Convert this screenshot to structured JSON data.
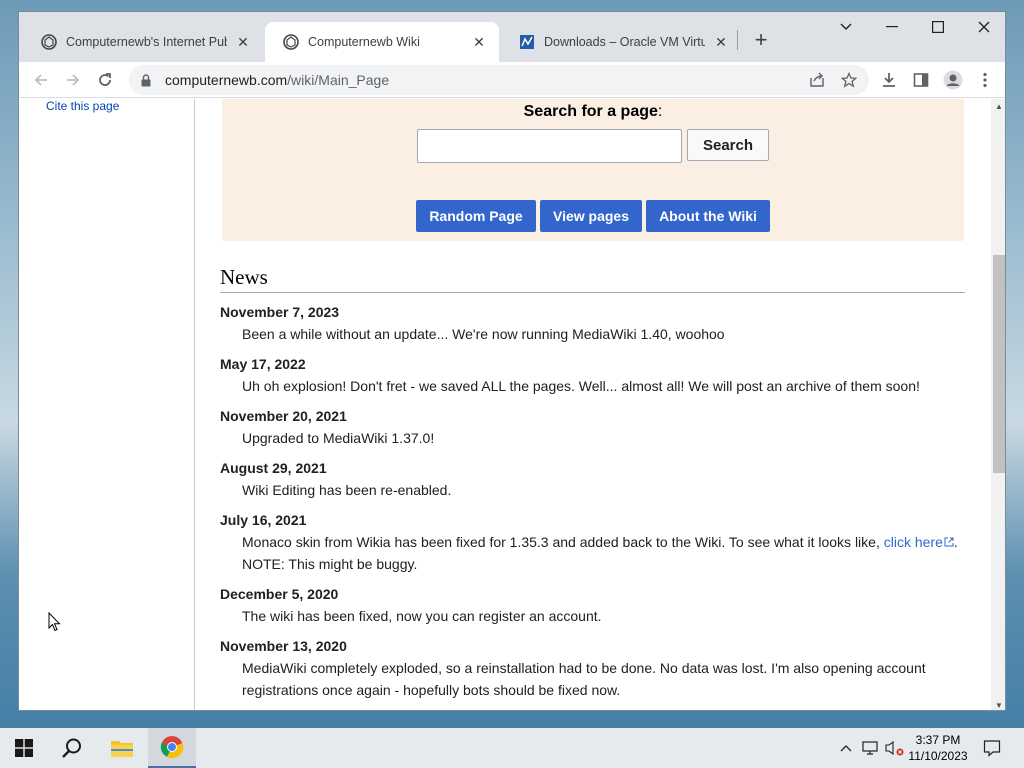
{
  "browser": {
    "tabs": [
      {
        "title": "Computernewb's Internet Pub H",
        "active": false
      },
      {
        "title": "Computernewb Wiki",
        "active": true
      },
      {
        "title": "Downloads – Oracle VM VirtualB",
        "active": false
      }
    ],
    "url_domain": "computernewb.com",
    "url_path": "/wiki/Main_Page"
  },
  "sidebar": {
    "link": "Cite this page"
  },
  "search_section": {
    "heading": "Search for a page",
    "heading_suffix": ":",
    "search_button": "Search",
    "buttons": [
      "Random Page",
      "View pages",
      "About the Wiki"
    ]
  },
  "news": {
    "title": "News",
    "items": [
      {
        "date": "November 7, 2023",
        "text": "Been a while without an update... We're now running MediaWiki 1.40, woohoo"
      },
      {
        "date": "May 17, 2022",
        "text": "Uh oh explosion! Don't fret - we saved ALL the pages. Well... almost all! We will post an archive of them soon!"
      },
      {
        "date": "November 20, 2021",
        "text": "Upgraded to MediaWiki 1.37.0!"
      },
      {
        "date": "August 29, 2021",
        "text": "Wiki Editing has been re-enabled."
      },
      {
        "date": "July 16, 2021",
        "text": "Monaco skin from Wikia has been fixed for 1.35.3 and added back to the Wiki. To see what it looks like, ",
        "link": "click here",
        "text_after": ". NOTE: This might be buggy."
      },
      {
        "date": "December 5, 2020",
        "text": "The wiki has been fixed, now you can register an account."
      },
      {
        "date": "November 13, 2020",
        "text": "MediaWiki completely exploded, so a reinstallation had to be done. No data was lost. I'm also opening account registrations once again - hopefully bots should be fixed now."
      }
    ]
  },
  "taskbar": {
    "time": "3:37 PM",
    "date": "11/10/2023"
  },
  "colors": {
    "link": "#3366cc",
    "button_blue": "#3366cc",
    "search_bg": "#fbeee2"
  }
}
